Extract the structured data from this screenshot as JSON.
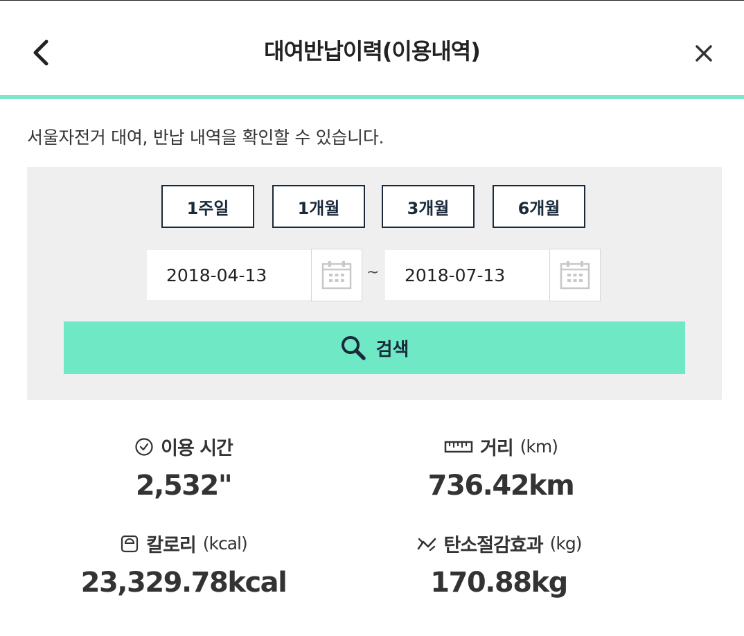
{
  "header": {
    "title": "대여반납이력(이용내역)",
    "back_icon": "chevron-left-icon",
    "close_icon": "close-icon"
  },
  "description": "서울자전거 대여, 반납 내역을 확인할 수 있습니다.",
  "search": {
    "periods": [
      "1주일",
      "1개월",
      "3개월",
      "6개월"
    ],
    "start_date": "2018-04-13",
    "end_date": "2018-07-13",
    "range_separator": "~",
    "calendar_icon": "calendar-icon",
    "search_icon": "search-icon",
    "search_label": "검색"
  },
  "stats": {
    "usage_time": {
      "label": "이용 시간",
      "unit": "",
      "value": "2,532\"",
      "icon": "clock-icon"
    },
    "distance": {
      "label": "거리",
      "unit": "(km)",
      "value": "736.42km",
      "icon": "ruler-icon"
    },
    "calories": {
      "label": "칼로리",
      "unit": "(kcal)",
      "value": "23,329.78kcal",
      "icon": "scale-icon"
    },
    "carbon": {
      "label": "탄소절감효과",
      "unit": "(kg)",
      "value": "170.88kg",
      "icon": "trend-icon"
    }
  },
  "colors": {
    "accent": "#6fe8c6",
    "header_rule": "#7fe6c8",
    "panel_bg": "#efefef",
    "button_border": "#1a2a3a"
  }
}
